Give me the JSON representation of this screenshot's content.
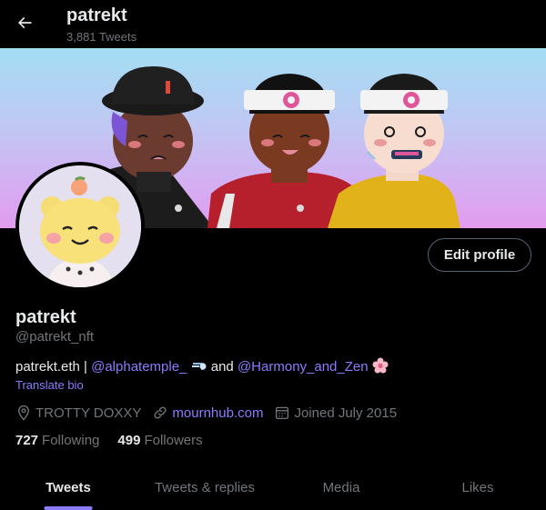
{
  "header": {
    "title": "patrekt",
    "tweet_count": "3,881 Tweets"
  },
  "profile": {
    "display_name": "patrekt",
    "handle": "@patrekt_nft",
    "edit_label": "Edit profile",
    "bio": {
      "prefix": "patrekt.eth | ",
      "mention1": "@alphatemple_",
      "connector": " and ",
      "mention2": "@Harmony_and_Zen"
    },
    "translate_label": "Translate bio",
    "location": "TROTTY DOXXY",
    "website": "mournhub.com",
    "joined": "Joined July 2015",
    "following_count": "727",
    "following_label": "Following",
    "followers_count": "499",
    "followers_label": "Followers"
  },
  "tabs": [
    {
      "label": "Tweets"
    },
    {
      "label": "Tweets & replies"
    },
    {
      "label": "Media"
    },
    {
      "label": "Likes"
    }
  ],
  "colors": {
    "accent": "#8a7cff",
    "muted": "#71767b",
    "text": "#e7e9ea",
    "background": "#000000"
  },
  "icons": [
    "back-arrow-icon",
    "location-pin-icon",
    "link-icon",
    "calendar-icon",
    "dash-emoji-icon",
    "blossom-emoji-icon"
  ]
}
